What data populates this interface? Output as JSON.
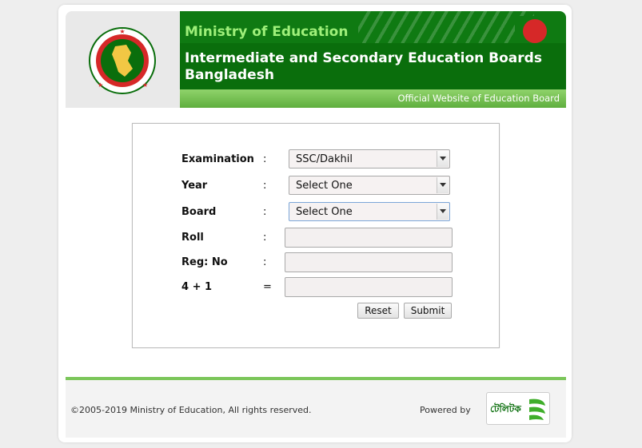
{
  "header": {
    "ministry": "Ministry of Education",
    "org_line1": "Intermediate and Secondary Education Boards",
    "org_line2": "Bangladesh",
    "tagline": "Official Website of Education Board",
    "seal_text": "গণপ্রজাতন্ত্রী বাংলাদেশ সরকার",
    "colors": {
      "dark_green": "#0a6e0c",
      "light_green": "#9ff07a",
      "flag_red": "#d62828"
    }
  },
  "form": {
    "fields": [
      {
        "label": "Examination",
        "sep": ":",
        "type": "select",
        "value": "SSC/Dakhil"
      },
      {
        "label": "Year",
        "sep": ":",
        "type": "select",
        "value": "Select One"
      },
      {
        "label": "Board",
        "sep": ":",
        "type": "select",
        "value": "Select One"
      },
      {
        "label": "Roll",
        "sep": ":",
        "type": "text",
        "value": ""
      },
      {
        "label": "Reg: No",
        "sep": ":",
        "type": "text",
        "value": ""
      },
      {
        "label": "4 + 1",
        "sep": "=",
        "type": "text",
        "value": ""
      }
    ],
    "reset_label": "Reset",
    "submit_label": "Submit"
  },
  "footer": {
    "copyright": "©2005-2019 Ministry of Education, All rights reserved.",
    "powered_by": "Powered by",
    "brand": "টেলিটক",
    "icon": "teletalk-logo"
  }
}
